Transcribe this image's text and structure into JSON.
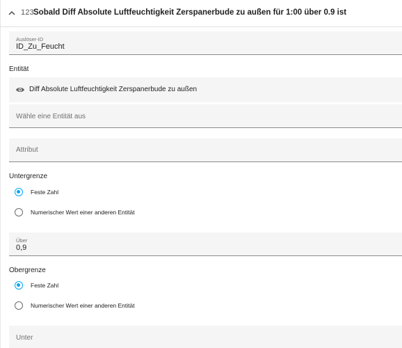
{
  "header": {
    "type_label": "123",
    "title": "Sobald Diff Absolute Luftfeuchtigkeit Zerspanerbude zu außen für 1:00 über 0.9 ist"
  },
  "trigger_id": {
    "label": "Auslöser-ID",
    "value": "ID_Zu_Feucht"
  },
  "entity_section": {
    "label": "Entität",
    "selected_entity": "Diff Absolute Luftfeuchtigkeit Zerspanerbude zu außen",
    "select_placeholder": "Wähle eine Entität aus"
  },
  "attribute": {
    "placeholder": "Attribut"
  },
  "lower_limit": {
    "label": "Untergrenze",
    "options": [
      "Feste Zahl",
      "Numerischer Wert einer anderen Entität"
    ],
    "selected_index": 0
  },
  "above": {
    "label": "Über",
    "value": "0,9"
  },
  "upper_limit": {
    "label": "Obergrenze",
    "options": [
      "Feste Zahl",
      "Numerischer Wert einer anderen Entität"
    ],
    "selected_index": 0
  },
  "below": {
    "placeholder": "Unter"
  },
  "colors": {
    "accent": "#03a9f4",
    "field_bg": "#f5f5f5"
  }
}
